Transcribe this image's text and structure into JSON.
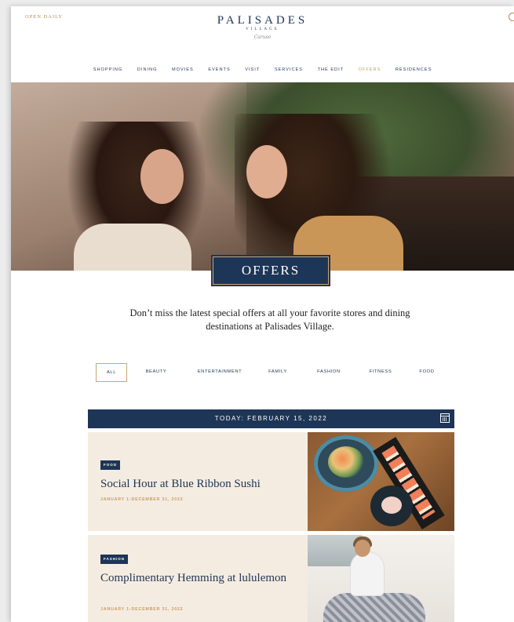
{
  "header": {
    "open_daily": "OPEN DAILY",
    "logo_main": "PALISADES",
    "logo_sub": "VILLAGE",
    "logo_script": "Caruso",
    "search_icon": "search-icon"
  },
  "nav": {
    "items": [
      "SHOPPING",
      "DINING",
      "MOVIES",
      "EVENTS",
      "VISIT",
      "SERVICES",
      "THE EDIT",
      "OFFERS",
      "RESIDENCES"
    ],
    "active": "OFFERS"
  },
  "hero": {
    "badge": "OFFERS"
  },
  "intro": "Don’t miss the latest special offers at all your favorite stores and dining destinations at Palisades Village.",
  "filters": [
    "ALL",
    "BEAUTY",
    "ENTERTAINMENT",
    "FAMILY",
    "FASHION",
    "FITNESS",
    "FOOD"
  ],
  "active_filter": "ALL",
  "date_bar": {
    "label": "TODAY: FEBRUARY 15, 2022",
    "icon": "calendar-icon"
  },
  "offers": [
    {
      "tag": "FOOD",
      "title": "Social Hour at Blue Ribbon Sushi",
      "dates": "JANUARY 1-DECEMBER 31, 2022"
    },
    {
      "tag": "FASHION",
      "title": "Complimentary Hemming at lululemon",
      "dates": "JANUARY 1-DECEMBER 31, 2022"
    }
  ],
  "colors": {
    "navy": "#1d3556",
    "gold": "#c79d63",
    "card_bg": "#f5ece1"
  }
}
